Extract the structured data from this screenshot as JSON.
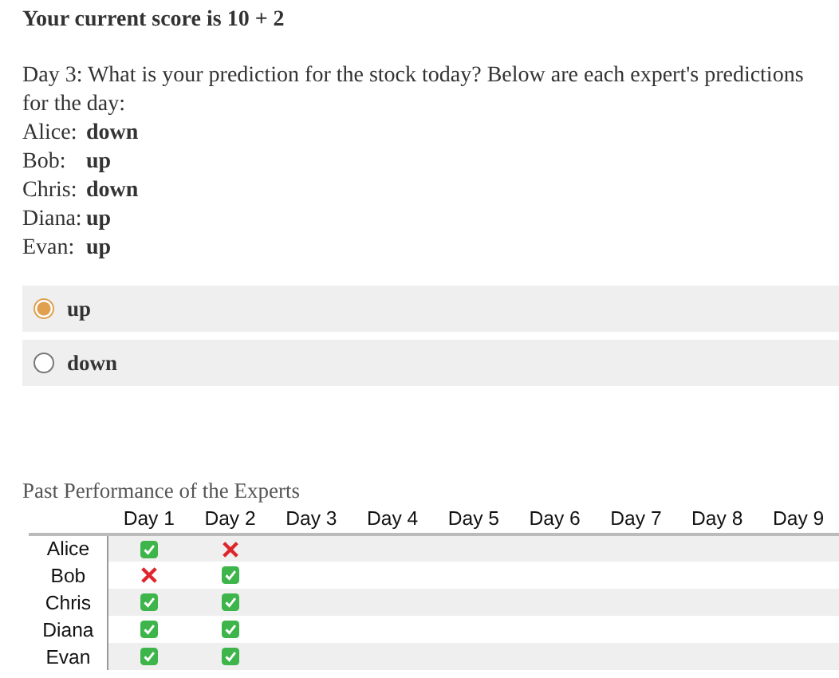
{
  "score_title": "Your current score is 10 + 2",
  "question": "Day 3: What is your prediction for the stock today? Below are each expert's predictions for the day:",
  "predictions": [
    {
      "name": "Alice:",
      "vote": "down"
    },
    {
      "name": "Bob:",
      "vote": "up"
    },
    {
      "name": "Chris:",
      "vote": "down"
    },
    {
      "name": "Diana:",
      "vote": "up"
    },
    {
      "name": "Evan:",
      "vote": "up"
    }
  ],
  "options": [
    {
      "label": "up",
      "selected": true
    },
    {
      "label": "down",
      "selected": false
    }
  ],
  "table": {
    "caption": "Past Performance of the Experts",
    "columns": [
      "Day 1",
      "Day 2",
      "Day 3",
      "Day 4",
      "Day 5",
      "Day 6",
      "Day 7",
      "Day 8",
      "Day 9"
    ],
    "rows": [
      {
        "name": "Alice",
        "results": [
          {
            "correct": true
          },
          {
            "correct": false
          }
        ]
      },
      {
        "name": "Bob",
        "results": [
          {
            "correct": false
          },
          {
            "correct": true
          }
        ]
      },
      {
        "name": "Chris",
        "results": [
          {
            "correct": true
          },
          {
            "correct": true
          }
        ]
      },
      {
        "name": "Diana",
        "results": [
          {
            "correct": true
          },
          {
            "correct": true
          }
        ]
      },
      {
        "name": "Evan",
        "results": [
          {
            "correct": true
          },
          {
            "correct": true
          }
        ]
      }
    ]
  }
}
